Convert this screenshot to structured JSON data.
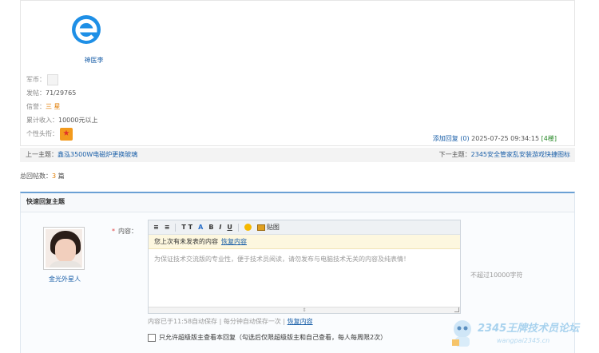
{
  "post": {
    "username": "神医李",
    "info": {
      "coin_label": "军币：",
      "posts_label": "发帖：",
      "posts_value": "71/29765",
      "credit_label": "信誉：",
      "credit_value": "三 星",
      "income_label": "累计收入：",
      "income_value": "10000元以上",
      "avatar_label": "个性头衔："
    },
    "add_reply": "添加回复",
    "reply_count": "(0)",
    "timestamp": "2025-07-25 09:34:15",
    "floor": "[4楼]"
  },
  "nav": {
    "prev_label": "上一主题：",
    "prev_title": "鑫泓3500W电磁炉更换玻璃",
    "next_label": "下一主题：",
    "next_title": "2345安全管家乱安装游戏快捷图标"
  },
  "total": {
    "label": "总回帖数：",
    "count": "3",
    "unit": "篇"
  },
  "reply": {
    "header": "快速回复主题",
    "username": "金光外星人",
    "required_mark": "*",
    "content_label": "内容：",
    "toolbar": {
      "align_left": "≡",
      "align_justify": "≡",
      "font_size": "T T",
      "font_color": "A",
      "bold": "B",
      "italic": "I",
      "underline": "U",
      "image_label": "贴图"
    },
    "restore_text": "您上次有未发表的内容",
    "restore_link": "恢复内容",
    "placeholder": "为保证技术交流版的专业性，便于技术员阅读，请勿发布与电脑技术无关的内容及纯表情！",
    "resize_glyph": "⇕",
    "limit_note": "不超过10000字符",
    "autosave_text": "内容已于11:58自动保存  |  每分钟自动保存一次  |",
    "autosave_restore": "恢复内容",
    "moderator_only": "只允许超级版主查看本回复（勾选后仅限超级版主和自己查看，每人每周限2次）"
  },
  "watermark": {
    "title": "2345王牌技术员论坛",
    "url": "wangpai2345.cn"
  },
  "colors": {
    "link": "#1a5fa8",
    "accent_orange": "#e07b00",
    "reply_border": "#6aa0d4",
    "restore_bg": "#fdf7df"
  },
  "icons": [
    "browser-e-logo-icon",
    "title-badge-icon",
    "smile-icon",
    "image-icon",
    "mascot-icon"
  ]
}
